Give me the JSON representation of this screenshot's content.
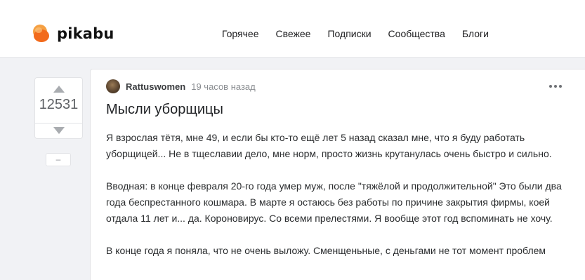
{
  "header": {
    "logo_text": "pikabu",
    "nav": [
      {
        "label": "Горячее"
      },
      {
        "label": "Свежее"
      },
      {
        "label": "Подписки"
      },
      {
        "label": "Сообщества"
      },
      {
        "label": "Блоги"
      }
    ]
  },
  "rating": {
    "count": "12531",
    "collapse_label": "–"
  },
  "post": {
    "author": "Rattuswomen",
    "time": "19 часов назад",
    "title": "Мысли уборщицы",
    "paragraphs": [
      "Я взрослая тётя, мне 49, и если бы кто-то ещё лет 5 назад сказал мне, что я буду работать уборщицей... Не в тщеславии дело, мне норм, просто жизнь крутанулась очень быстро и сильно.",
      "Вводная: в конце февраля 20-го года умер муж, после \"тяжёлой и продолжительной\" Это были два года беспрестанного кошмара. В марте я остаюсь без работы по причине закрытия фирмы, коей отдала 11 лет и... да. Короновирус. Со всеми прелестями. Я вообще этот год вспоминать не хочу.",
      "В конце года я поняла, что не очень выложу. Сменщеньные, с деньгами не тот момент проблем"
    ]
  },
  "colors": {
    "brand_orange": "#f26a1b",
    "vote_arrow": "#a9acb0"
  }
}
